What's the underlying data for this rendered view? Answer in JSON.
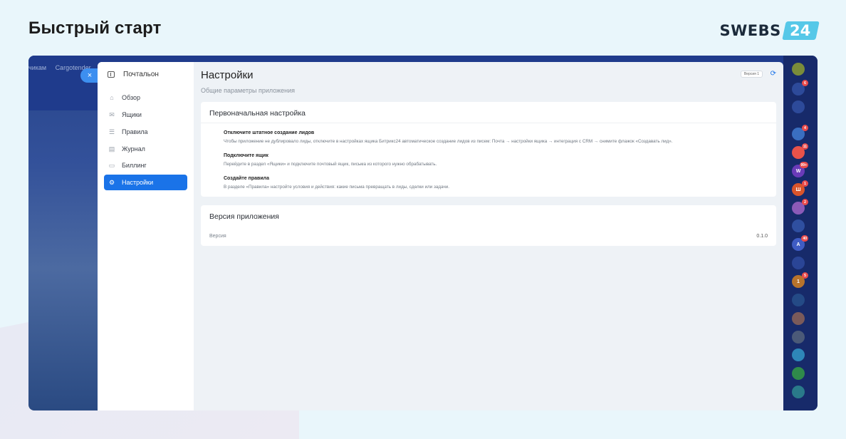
{
  "page": {
    "heading": "Быстрый старт"
  },
  "brand": {
    "word": "SWEBS",
    "number": "24"
  },
  "colors": {
    "accent": "#1a73e8",
    "window_bg": "#1f3b8c",
    "right_panel": "#172a6a"
  },
  "background_window": {
    "crumbs": [
      "чикам",
      "Cargotender"
    ],
    "close_glyph": "×"
  },
  "sidebar": {
    "app_name": "Почтальон",
    "items": [
      {
        "label": "Обзор",
        "icon": "home-icon",
        "active": false
      },
      {
        "label": "Ящики",
        "icon": "mail-icon",
        "active": false
      },
      {
        "label": "Правила",
        "icon": "list-icon",
        "active": false
      },
      {
        "label": "Журнал",
        "icon": "journal-icon",
        "active": false
      },
      {
        "label": "Биллинг",
        "icon": "wallet-icon",
        "active": false
      },
      {
        "label": "Настройки",
        "icon": "gear-icon",
        "active": true
      }
    ]
  },
  "main": {
    "title": "Настройки",
    "subtitle": "Общие параметры приложения",
    "version_chip": "Версия 1",
    "setup_card": {
      "title": "Первоначальная настройка",
      "steps": [
        {
          "heading": "Отключите штатное создание лидов",
          "description": "Чтобы приложение не дублировало лиды, отключите в настройках ящика Битрикс24 автоматическое создание лидов из писем: Почта → настройки ящика → интеграция с CRM → снимите флажок «Создавать лид»."
        },
        {
          "heading": "Подключите ящик",
          "description": "Перейдите в раздел «Ящики» и подключите почтовый ящик, письма из которого нужно обрабатывать."
        },
        {
          "heading": "Создайте правила",
          "description": "В разделе «Правила» настройте условия и действия: какие письма превращать в лиды, сделки или задачи."
        }
      ]
    },
    "version_card": {
      "title": "Версия приложения",
      "label": "Версия",
      "value": "0.1.0"
    }
  },
  "right_panel": {
    "items": [
      {
        "icon": "avatar-icon",
        "text": "",
        "badge": "",
        "color": "#7a8c3a"
      },
      {
        "icon": "bell-icon",
        "text": "",
        "badge": "6",
        "color": "#2d4a9a"
      },
      {
        "icon": "search-chat-icon",
        "text": "",
        "badge": "",
        "color": "#2d4a9a"
      },
      {
        "icon": "globe-icon",
        "text": "",
        "badge": "4",
        "color": "#3a6fc1"
      },
      {
        "icon": "flame-icon",
        "text": "",
        "badge": "11",
        "color": "#e8524a"
      },
      {
        "icon": "chat-avatar-icon",
        "text": "W",
        "badge": "99+",
        "color": "#6a3bb8"
      },
      {
        "icon": "chat-avatar-icon",
        "text": "Ш",
        "badge": "1",
        "color": "#d9542b"
      },
      {
        "icon": "chat-avatar-icon",
        "text": "",
        "badge": "2",
        "color": "#8b5ab8"
      },
      {
        "icon": "chat-avatar-icon",
        "text": "",
        "badge": "",
        "color": "#2f4fa0"
      },
      {
        "icon": "chat-avatar-icon",
        "text": "A",
        "badge": "40",
        "color": "#3f5cc4"
      },
      {
        "icon": "chat-avatar-icon",
        "text": "",
        "badge": "",
        "color": "#2a4596"
      },
      {
        "icon": "chat-avatar-icon",
        "text": "1",
        "badge": "5",
        "color": "#b8732c"
      },
      {
        "icon": "chat-avatar-icon",
        "text": "",
        "badge": "",
        "color": "#244a86"
      },
      {
        "icon": "chat-avatar-icon",
        "text": "",
        "badge": "",
        "color": "#7a5a5a"
      },
      {
        "icon": "chat-avatar-icon",
        "text": "",
        "badge": "",
        "color": "#4b5a78"
      },
      {
        "icon": "chat-avatar-icon",
        "text": "",
        "badge": "",
        "color": "#2e86b8"
      },
      {
        "icon": "chat-avatar-icon",
        "text": "",
        "badge": "",
        "color": "#2f8a4a"
      },
      {
        "icon": "chat-avatar-icon",
        "text": "",
        "badge": "",
        "color": "#2a7a8a"
      }
    ]
  }
}
